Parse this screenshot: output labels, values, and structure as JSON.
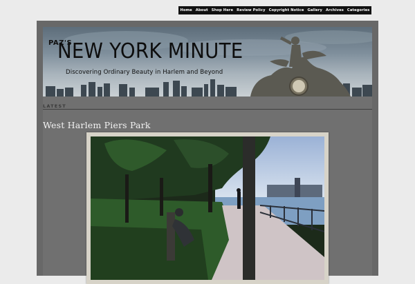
{
  "nav": {
    "items": [
      {
        "label": "Home",
        "name": "nav-home"
      },
      {
        "label": "About",
        "name": "nav-about"
      },
      {
        "label": "Shop Here",
        "name": "nav-shop-here"
      },
      {
        "label": "Review Policy",
        "name": "nav-review-policy"
      },
      {
        "label": "Copyright Notice",
        "name": "nav-copyright-notice"
      },
      {
        "label": "Gallery",
        "name": "nav-gallery"
      },
      {
        "label": "Archives",
        "name": "nav-archives"
      },
      {
        "label": "Categories",
        "name": "nav-categories"
      }
    ]
  },
  "header": {
    "subtitle": "PAZ'S",
    "title": "NEW YORK MINUTE",
    "tagline": "Discovering Ordinary Beauty in Harlem and Beyond"
  },
  "section": {
    "label": "LATEST"
  },
  "post": {
    "title": "West Harlem Piers Park"
  }
}
